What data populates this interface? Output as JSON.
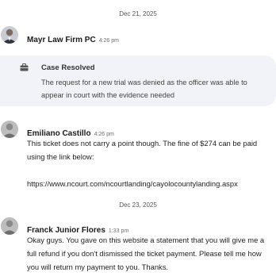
{
  "dividers": [
    "Dec 21, 2025",
    "Dec 23, 2025"
  ],
  "messages": [
    {
      "sender": "Mayr Law Firm PC",
      "time": "4:26 pm"
    },
    {
      "sender": "Emiliano Castillo",
      "time": "4:26 pm",
      "text": "This ticket does not carry a point though. The fine of $274 can be paid using the link below:\n\nhttps://www.ncourt.com/ncourtlanding/cayolocountylanding.aspx"
    },
    {
      "sender": "Franck Junior Flores",
      "time": "1:33 pm",
      "text": "Okay guys. You gave on this website a statement that you will give me a full refund if you don't dismissed the ticket payment. Please tell me how you will return my payment to you. Thanks."
    }
  ],
  "status_card": {
    "icon": "briefcase-icon",
    "title": "Case Resolved",
    "body": "The request for a new trial was denied as the officer was able to appear in court with the evidence needed"
  }
}
